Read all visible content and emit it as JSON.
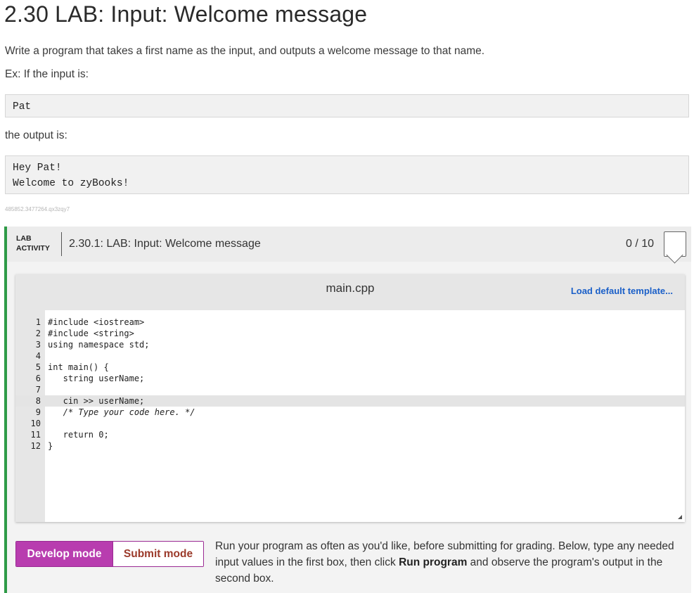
{
  "page": {
    "title": "2.30 LAB: Input: Welcome message",
    "description": "Write a program that takes a first name as the input, and outputs a welcome message to that name.",
    "example_intro": "Ex: If the input is:",
    "example_input": "Pat",
    "output_intro": "the output is:",
    "example_output_line1": "Hey Pat!",
    "example_output_line2": "Welcome to zyBooks!",
    "reference_id": "485852.3477264.qx3zqy7"
  },
  "lab": {
    "tag_line1": "LAB",
    "tag_line2": "ACTIVITY",
    "title": "2.30.1: LAB: Input: Welcome message",
    "score": "0 / 10",
    "accent_color": "#2e9a47"
  },
  "editor": {
    "file_name": "main.cpp",
    "load_template_label": "Load default template...",
    "link_color": "#1a5fc8",
    "lines": [
      {
        "num": "1",
        "code": "#include <iostream>"
      },
      {
        "num": "2",
        "code": "#include <string>"
      },
      {
        "num": "3",
        "code": "using namespace std;"
      },
      {
        "num": "4",
        "code": ""
      },
      {
        "num": "5",
        "code": "int main() {"
      },
      {
        "num": "6",
        "code": "   string userName;"
      },
      {
        "num": "7",
        "code": ""
      },
      {
        "num": "8",
        "code": "   cin >> userName;"
      },
      {
        "num": "9",
        "code": "   /* Type your code here. */"
      },
      {
        "num": "10",
        "code": ""
      },
      {
        "num": "11",
        "code": "   return 0;"
      },
      {
        "num": "12",
        "code": "}"
      }
    ]
  },
  "modes": {
    "develop_label": "Develop mode",
    "submit_label": "Submit mode",
    "active_color": "#b83daf"
  },
  "instructions": {
    "text_before": "Run your program as often as you'd like, before submitting for grading. Below, type any needed input values in the first box, then click ",
    "bold": "Run program",
    "text_after": " and observe the program's output in the second box."
  }
}
